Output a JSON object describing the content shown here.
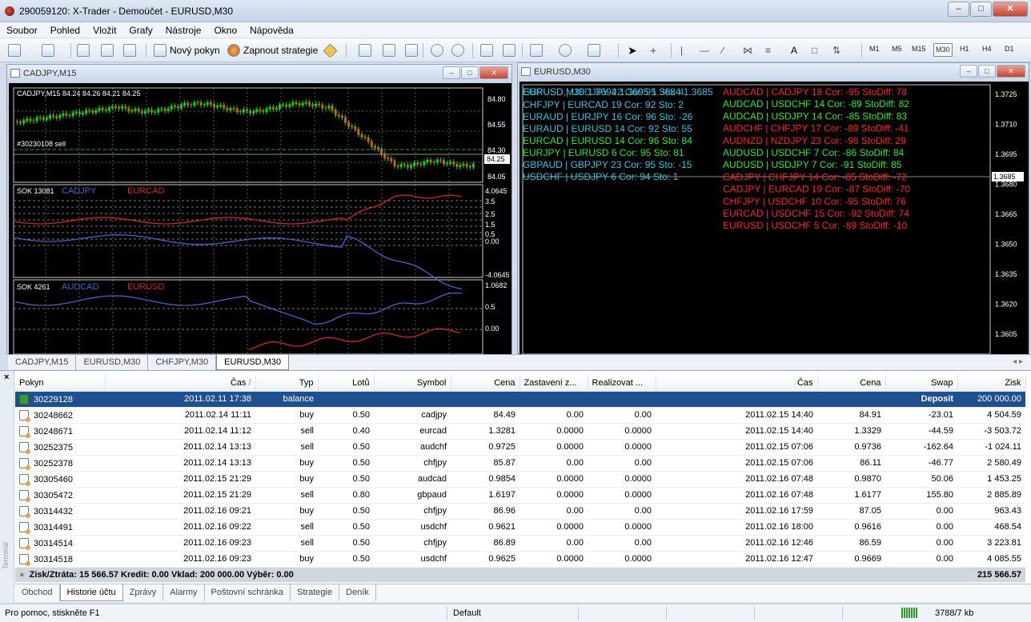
{
  "window": {
    "title": "290059120: X-Trader - Demoúčet - EURUSD,M30"
  },
  "menu": [
    "Soubor",
    "Pohled",
    "Vložit",
    "Grafy",
    "Nástroje",
    "Okno",
    "Nápověda"
  ],
  "toolbar": {
    "new_order": "Nový pokyn",
    "strategy": "Zapnout strategie",
    "text_tool": "A",
    "timeframes": [
      "M1",
      "M5",
      "M15",
      "M30",
      "H1",
      "H4",
      "D1"
    ],
    "active_timeframe": "M30"
  },
  "chart_left": {
    "title": "CADJPY,M15",
    "header": "CADJPY,M15  84.24 84.26 84.21 84.25",
    "order_label": "#30230108 sell",
    "price_ticks": [
      "84.80",
      "84.55",
      "84.30",
      "84.05"
    ],
    "current_price": "84.25",
    "ind1": {
      "name": "SOK 13081",
      "l1": "CADJPY",
      "l2": "EURCAD",
      "ticks": [
        "4.0645",
        "3.5",
        "2.5",
        "1.5",
        "0.5",
        "0.00",
        "-4.0645"
      ]
    },
    "ind2": {
      "name": "SOK 4261",
      "l1": "AUDCAD",
      "l2": "EURUSD",
      "ticks": [
        "1.0682",
        "0.5",
        "0.00"
      ]
    }
  },
  "chart_right": {
    "title": "EURUSD,M30",
    "header": "EURUSD,M30  1.3694 1.3695 1.3684 1.3685",
    "current_price": "1.3685",
    "price_ticks": [
      "1.3725",
      "1.3710",
      "1.3695",
      "1.3680",
      "1.3665",
      "1.3650",
      "1.3635",
      "1.3620",
      "1.3605"
    ],
    "cyan_rows": [
      "GBPUSD | USDJPY 22  Cor: 95  Sto: 4",
      "CHFJPY | EURCAD 19  Cor: 92  Sto: 2",
      "EURAUD | EURJPY 16  Cor: 96  Sto: -26",
      "EURAUD | EURUSD 14  Cor: 92  Sto: 55"
    ],
    "green_rows": [
      "EURCAD | EURUSD 14  Cor: 96  Sto: 84",
      "EURJPY | EURUSD 6  Cor: 95  Sto: 81",
      "GBPAUD | GBPJPY 23  Cor: 95  Sto: -15"
    ],
    "cyan_last": "USDCHF | USDJPY 6  Cor: 94  Sto: 1",
    "right_rows": [
      {
        "t": "AUDCAD | CADJPY 18  Cor: -95  StoDiff: 78",
        "c": "#ff2020"
      },
      {
        "t": "AUDCAD | USDCHF 14  Cor: -89  StoDiff: 82",
        "c": "#22ee22"
      },
      {
        "t": "AUDCAD | USDJPY 14  Cor: -85  StoDiff: 83",
        "c": "#22ee22"
      },
      {
        "t": "AUDCHF | CHFJPY 17  Cor: -89  StoDiff: -41",
        "c": "#ff2020"
      },
      {
        "t": "AUDNZD | NZDJPY 23  Cor: -96  StoDiff: 29",
        "c": "#ff2020"
      },
      {
        "t": "AUDUSD | USDCHF 7  Cor: -86  StoDiff: 84",
        "c": "#22ee22"
      },
      {
        "t": "AUDUSD | USDJPY 7  Cor: -91  StoDiff: 85",
        "c": "#22ee22"
      },
      {
        "t": "CADJPY | CHFJPY 14  Cor: -85  StoDiff: -72",
        "c": "#ff2020"
      },
      {
        "t": "CADJPY | EURCAD 19  Cor: -87  StoDiff: -70",
        "c": "#ff2020"
      },
      {
        "t": "CHFJPY | USDCHF 10  Cor: -95  StoDiff: 76",
        "c": "#ff2020"
      },
      {
        "t": "EURCAD | USDCHF 15  Cor: -92  StoDiff: 74",
        "c": "#ff2020"
      },
      {
        "t": "EURUSD | USDCHF 5  Cor: -89  StoDiff: -10",
        "c": "#ff2020"
      }
    ]
  },
  "chart_tabs": [
    "CADJPY,M15",
    "EURUSD,M30",
    "CHFJPY,M30",
    "EURUSD,M30"
  ],
  "table": {
    "columns": [
      "Pokyn",
      "Čas",
      "Typ",
      "Lotů",
      "Symbol",
      "Cena",
      "Zastavení z...",
      "Realizovat ...",
      "Čas",
      "Cena",
      "Swap",
      "Zisk"
    ],
    "balance": {
      "order": "30229128",
      "time": "2011.02.11 17:38",
      "type": "balance",
      "swap": "Deposit",
      "profit": "200 000.00"
    },
    "rows": [
      [
        "30248662",
        "2011.02.14 11:11",
        "buy",
        "0.50",
        "cadjpy",
        "84.49",
        "0.00",
        "0.00",
        "2011.02.15 14:40",
        "84.91",
        "-23.01",
        "4 504.59"
      ],
      [
        "30248671",
        "2011.02.14 11:12",
        "sell",
        "0.40",
        "eurcad",
        "1.3281",
        "0.0000",
        "0.0000",
        "2011.02.15 14:40",
        "1.3329",
        "-44.59",
        "-3 503.72"
      ],
      [
        "30252375",
        "2011.02.14 13:13",
        "sell",
        "0.50",
        "audchf",
        "0.9725",
        "0.0000",
        "0.0000",
        "2011.02.15 07:06",
        "0.9736",
        "-162.64",
        "-1 024.11"
      ],
      [
        "30252378",
        "2011.02.14 13:13",
        "buy",
        "0.50",
        "chfjpy",
        "85.87",
        "0.00",
        "0.00",
        "2011.02.15 07:06",
        "86.11",
        "-46.77",
        "2 580.49"
      ],
      [
        "30305460",
        "2011.02.15 21:29",
        "buy",
        "0.50",
        "audcad",
        "0.9854",
        "0.0000",
        "0.0000",
        "2011.02.16 07:48",
        "0.9870",
        "50.06",
        "1 453.25"
      ],
      [
        "30305472",
        "2011.02.15 21:29",
        "sell",
        "0.80",
        "gbpaud",
        "1.6197",
        "0.0000",
        "0.0000",
        "2011.02.16 07:48",
        "1.6177",
        "155.80",
        "2 885.89"
      ],
      [
        "30314432",
        "2011.02.16 09:21",
        "buy",
        "0.50",
        "chfjpy",
        "86.96",
        "0.00",
        "0.00",
        "2011.02.16 17:59",
        "87.05",
        "0.00",
        "963.43"
      ],
      [
        "30314491",
        "2011.02.16 09:22",
        "sell",
        "0.50",
        "usdchf",
        "0.9621",
        "0.0000",
        "0.0000",
        "2011.02.16 18:00",
        "0.9616",
        "0.00",
        "468.54"
      ],
      [
        "30314514",
        "2011.02.16 09:23",
        "sell",
        "0.50",
        "chfjpy",
        "86.89",
        "0.00",
        "0.00",
        "2011.02.16 12:46",
        "86.59",
        "0.00",
        "3 223.81"
      ],
      [
        "30314518",
        "2011.02.16 09:23",
        "buy",
        "0.50",
        "usdchf",
        "0.9625",
        "0.0000",
        "0.0000",
        "2011.02.16 12:47",
        "0.9669",
        "0.00",
        "4 085.55"
      ]
    ],
    "summary": "Zisk/Ztráta: 15 566.57  Kredit: 0.00  Vklad: 200 000.00  Výběr: 0.00",
    "summary_total": "215 566.57"
  },
  "terminal_label": "Terminál",
  "terminal_tabs": [
    "Obchod",
    "Historie účtu",
    "Zprávy",
    "Alarmy",
    "Poštovní schránka",
    "Strategie",
    "Deník"
  ],
  "active_terminal_tab": "Historie účtu",
  "status": {
    "help": "Pro pomoc, stiskněte F1",
    "profile": "Default",
    "traffic": "3788/7 kb"
  }
}
